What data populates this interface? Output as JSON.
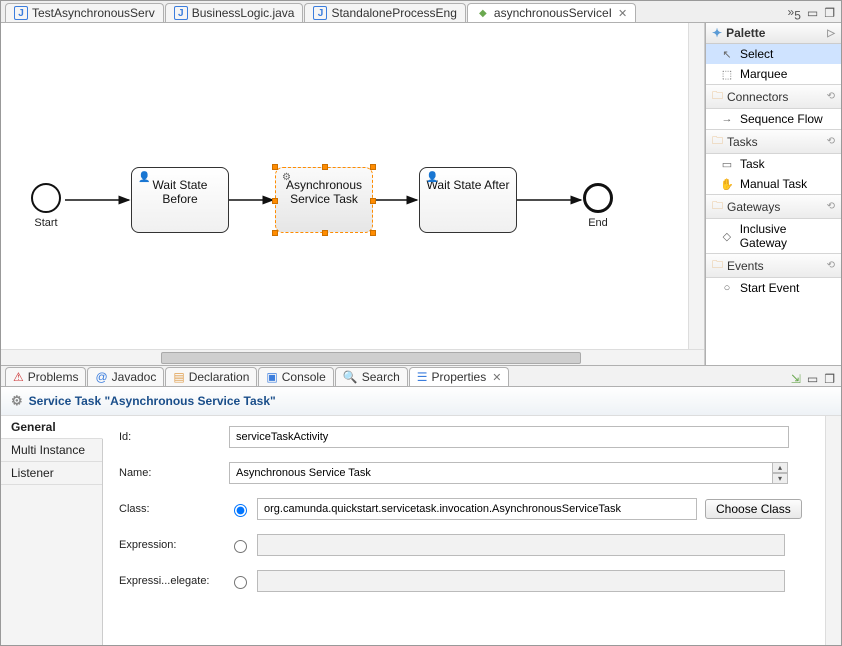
{
  "editor_tabs": {
    "t0": "TestAsynchronousServ",
    "t1": "BusinessLogic.java",
    "t2": "StandaloneProcessEng",
    "t3": "asynchronousServiceI",
    "overflow": "5"
  },
  "diagram": {
    "start_label": "Start",
    "wait_before": "Wait State Before",
    "async_task": "Asynchronous Service Task",
    "wait_after": "Wait State After",
    "end_label": "End"
  },
  "palette": {
    "header": "Palette",
    "select": "Select",
    "marquee": "Marquee",
    "grp_connectors": "Connectors",
    "sequence_flow": "Sequence Flow",
    "grp_tasks": "Tasks",
    "task": "Task",
    "manual_task": "Manual Task",
    "grp_gateways": "Gateways",
    "inclusive_gateway": "Inclusive Gateway",
    "grp_events": "Events",
    "start_event": "Start Event"
  },
  "views": {
    "problems": "Problems",
    "javadoc": "Javadoc",
    "declaration": "Declaration",
    "console": "Console",
    "search": "Search",
    "properties": "Properties"
  },
  "props": {
    "title": "Service Task \"Asynchronous Service Task\"",
    "side_general": "General",
    "side_multi": "Multi Instance",
    "side_listener": "Listener",
    "lbl_id": "Id:",
    "val_id": "serviceTaskActivity",
    "lbl_name": "Name:",
    "val_name": "Asynchronous Service Task",
    "lbl_class": "Class:",
    "val_class": "org.camunda.quickstart.servicetask.invocation.AsynchronousServiceTask",
    "btn_choose": "Choose Class",
    "lbl_expression": "Expression:",
    "lbl_expr_delegate": "Expressi...elegate:"
  }
}
